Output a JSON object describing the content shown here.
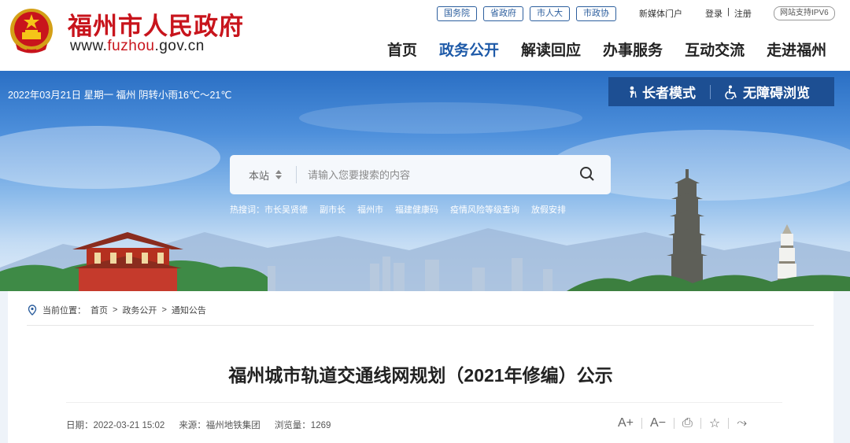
{
  "header": {
    "title": "福州市人民政府",
    "url_prefix": "www.",
    "url_accent": "fuzhou",
    "url_suffix": ".gov.cn",
    "top_links": [
      "国务院",
      "省政府",
      "市人大",
      "市政协"
    ],
    "media": "新媒体门户",
    "login": "登录",
    "auth_sep": "|",
    "register": "注册",
    "ipv6": "网站支持IPV6",
    "nav": [
      {
        "label": "首页",
        "active": false
      },
      {
        "label": "政务公开",
        "active": true
      },
      {
        "label": "解读回应",
        "active": false
      },
      {
        "label": "办事服务",
        "active": false
      },
      {
        "label": "互动交流",
        "active": false
      },
      {
        "label": "走进福州",
        "active": false
      }
    ]
  },
  "banner": {
    "weather": "2022年03月21日 星期一 福州 阴转小雨16℃～21℃",
    "elder_mode": "长者模式",
    "accessible": "无障碍浏览",
    "search": {
      "scope": "本站",
      "placeholder": "请输入您要搜索的内容"
    },
    "hot_label": "热搜词：",
    "hot_words": [
      "市长吴贤德",
      "副市长",
      "福州市",
      "福建健康码",
      "疫情风险等级查询",
      "放假安排"
    ]
  },
  "article": {
    "crumb_label": "当前位置：",
    "crumb": [
      "首页",
      "政务公开",
      "通知公告"
    ],
    "crumb_sep": ">",
    "title": "福州城市轨道交通线网规划（2021年修编）公示",
    "date": "日期：2022-03-21 15:02",
    "source": "来源：福州地铁集团",
    "views": "浏览量：1269",
    "tools": {
      "font_up": "A+",
      "font_down": "A−",
      "print": "⎙",
      "favorite": "☆",
      "share": "⤳"
    }
  },
  "colors": {
    "brand_red": "#c8141c",
    "nav_active": "#1e5aa8",
    "mode_bar": "#1d4f93"
  }
}
